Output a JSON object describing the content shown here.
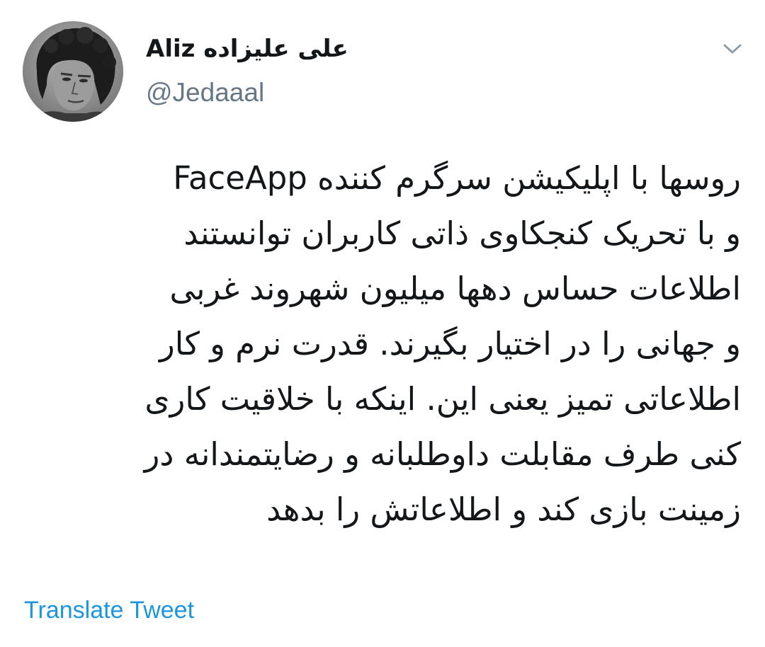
{
  "user": {
    "display_name": "علی علیزاده Aliz",
    "handle": "@Jedaaal"
  },
  "tweet": {
    "lines": [
      "روسها با اپلیکیشن سرگرم کننده FaceApp",
      "و با تحریک کنجکاوی ذاتی کاربران توانستند",
      "اطلاعات حساس دهها میلیون شهروند غربی",
      "و جهانی را در اختیار بگیرند. قدرت نرم و کار",
      "اطلاعاتی تمیز یعنی این. اینکه با خلاقیت کاری",
      "کنی طرف مقابلت داوطلبانه و رضایتمندانه در",
      "زمینت بازی کند و اطلاعاتش را بدهد"
    ]
  },
  "actions": {
    "translate_label": "Translate Tweet"
  },
  "icons": {
    "menu": "chevron-down-icon"
  },
  "colors": {
    "text": "#14171a",
    "secondary": "#657786",
    "link": "#1b95e0",
    "chevron": "#8899a6",
    "background": "#ffffff"
  }
}
